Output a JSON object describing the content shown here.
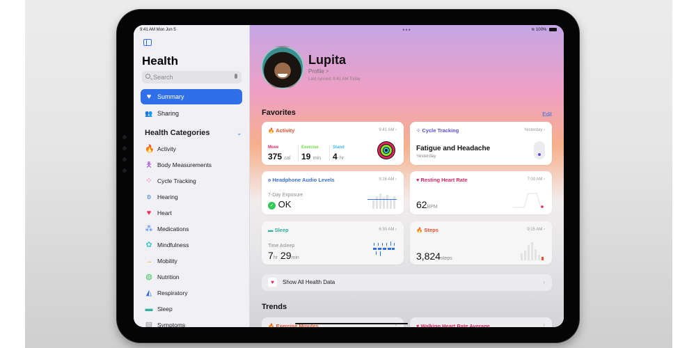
{
  "status_bar": {
    "time": "9:41 AM  Mon Jun 5",
    "battery": "100%"
  },
  "sidebar": {
    "title": "Health",
    "search": {
      "placeholder": "Search"
    },
    "nav": [
      {
        "label": "Summary",
        "icon": "heart-icon",
        "active": true
      },
      {
        "label": "Sharing",
        "icon": "people-icon",
        "active": false
      }
    ],
    "categories_header": "Health Categories",
    "categories": [
      {
        "label": "Activity",
        "icon": "flame-icon",
        "color": "#ff5a1f"
      },
      {
        "label": "Body Measurements",
        "icon": "figure-icon",
        "color": "#a040e0"
      },
      {
        "label": "Cycle Tracking",
        "icon": "cycle-icon",
        "color": "#ff375f"
      },
      {
        "label": "Hearing",
        "icon": "ear-icon",
        "color": "#3b82f6"
      },
      {
        "label": "Heart",
        "icon": "heart-icon",
        "color": "#ff2d55"
      },
      {
        "label": "Medications",
        "icon": "pills-icon",
        "color": "#3b82f6"
      },
      {
        "label": "Mindfulness",
        "icon": "flower-icon",
        "color": "#40c8c8"
      },
      {
        "label": "Mobility",
        "icon": "arrow-icon",
        "color": "#f5a623"
      },
      {
        "label": "Nutrition",
        "icon": "apple-icon",
        "color": "#34c759"
      },
      {
        "label": "Respiratory",
        "icon": "lungs-icon",
        "color": "#3b6fe0"
      },
      {
        "label": "Sleep",
        "icon": "bed-icon",
        "color": "#30b0a0"
      },
      {
        "label": "Symptoms",
        "icon": "clipboard-icon",
        "color": "#8e8e93"
      }
    ]
  },
  "profile": {
    "name": "Lupita",
    "link": "Profile >",
    "synced": "Last synced: 9:41 AM Today"
  },
  "favorites": {
    "title": "Favorites",
    "edit": "Edit",
    "activity": {
      "title": "Activity",
      "time": "9:41 AM",
      "move_label": "Move",
      "move_value": "375",
      "move_unit": "cal",
      "exercise_label": "Exercise",
      "exercise_value": "19",
      "exercise_unit": "min",
      "stand_label": "Stand",
      "stand_value": "4",
      "stand_unit": "hr"
    },
    "cycle": {
      "title": "Cycle Tracking",
      "time": "Yesterday",
      "value": "Fatigue and Headache",
      "sub": "Yesterday"
    },
    "headphone": {
      "title": "Headphone Audio Levels",
      "time": "9:16 AM",
      "label": "7-Day Exposure",
      "value": "OK"
    },
    "heart": {
      "title": "Resting Heart Rate",
      "time": "7:00 AM",
      "value": "62",
      "unit": "BPM"
    },
    "sleep": {
      "title": "Sleep",
      "time": "6:30 AM",
      "label": "Time Asleep",
      "hours": "7",
      "hours_unit": "hr",
      "mins": "29",
      "mins_unit": "min"
    },
    "steps": {
      "title": "Steps",
      "time": "9:15 AM",
      "value": "3,824",
      "unit": "steps"
    }
  },
  "show_all": "Show All Health Data",
  "trends": {
    "title": "Trends",
    "items": [
      "Exercise Minutes",
      "Walking Heart Rate Average"
    ]
  },
  "colors": {
    "accent": "#2f6fe8",
    "activity": "#e8502a",
    "cycle": "#5b4fd0",
    "headphone": "#3b6fe0",
    "heart": "#e0245e",
    "sleep": "#30b0a0",
    "steps": "#e8502a"
  }
}
